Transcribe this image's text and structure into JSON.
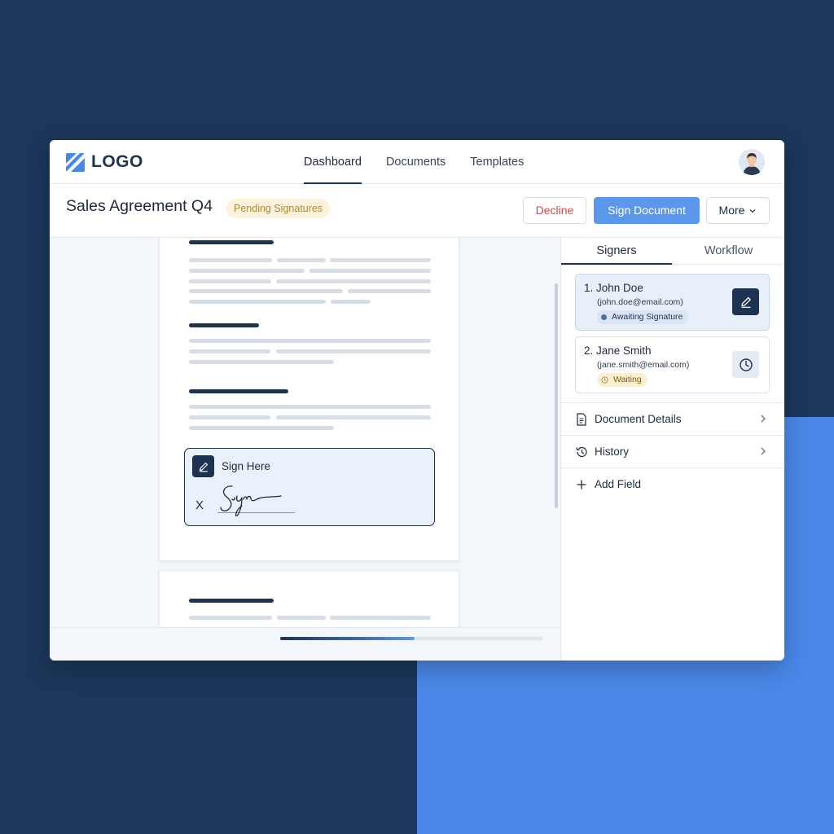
{
  "app": {
    "logo_text": "LOGO",
    "nav": [
      {
        "label": "Dashboard",
        "active": true
      },
      {
        "label": "Documents",
        "active": false
      },
      {
        "label": "Templates",
        "active": false
      }
    ]
  },
  "document": {
    "title": "Sales Agreement Q4",
    "status": "Pending Signatures",
    "actions": {
      "decline": "Decline",
      "sign": "Sign Document",
      "more": "More"
    },
    "sign_field": {
      "label": "Sign Here",
      "marker": "X"
    }
  },
  "panel": {
    "tabs": [
      {
        "label": "Signers",
        "active": true
      },
      {
        "label": "Workflow",
        "active": false
      }
    ],
    "signers": [
      {
        "number": "1.",
        "name": "John Doe",
        "email": "(john.doe@email.com)",
        "status": "Awaiting Signature"
      },
      {
        "number": "2.",
        "name": "Jane Smith",
        "email": "(jane.smith@email.com)",
        "status": "Waiting"
      }
    ],
    "rows": {
      "details": "Document Details",
      "history": "History",
      "add_field": "Add Field"
    }
  },
  "scroll": {
    "horizontal_position": 0.51
  },
  "colors": {
    "brand_dark": "#1e3352",
    "accent_blue": "#5b98ec",
    "decline_red": "#c94a4a",
    "pending_amber": "#b5862d"
  }
}
